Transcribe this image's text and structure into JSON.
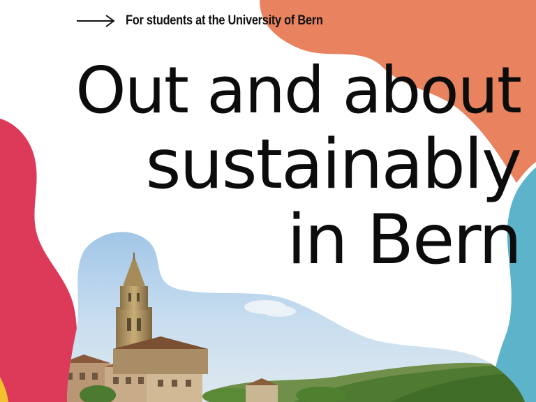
{
  "header": {
    "arrow_icon": "arrow-right-icon",
    "subtitle": "For students at the University of Bern"
  },
  "headline": {
    "line1": "Out and about",
    "line2": "sustainably",
    "line3": "in Bern"
  },
  "colors": {
    "orange_blob": "#E8825F",
    "red_blob": "#DD3A5A",
    "blue_blob": "#5DB3C9",
    "yellow_accent": "#F2C12E",
    "text": "#0c0c0c"
  },
  "photo": {
    "subject": "Bern Minster and old town with river Aare"
  }
}
